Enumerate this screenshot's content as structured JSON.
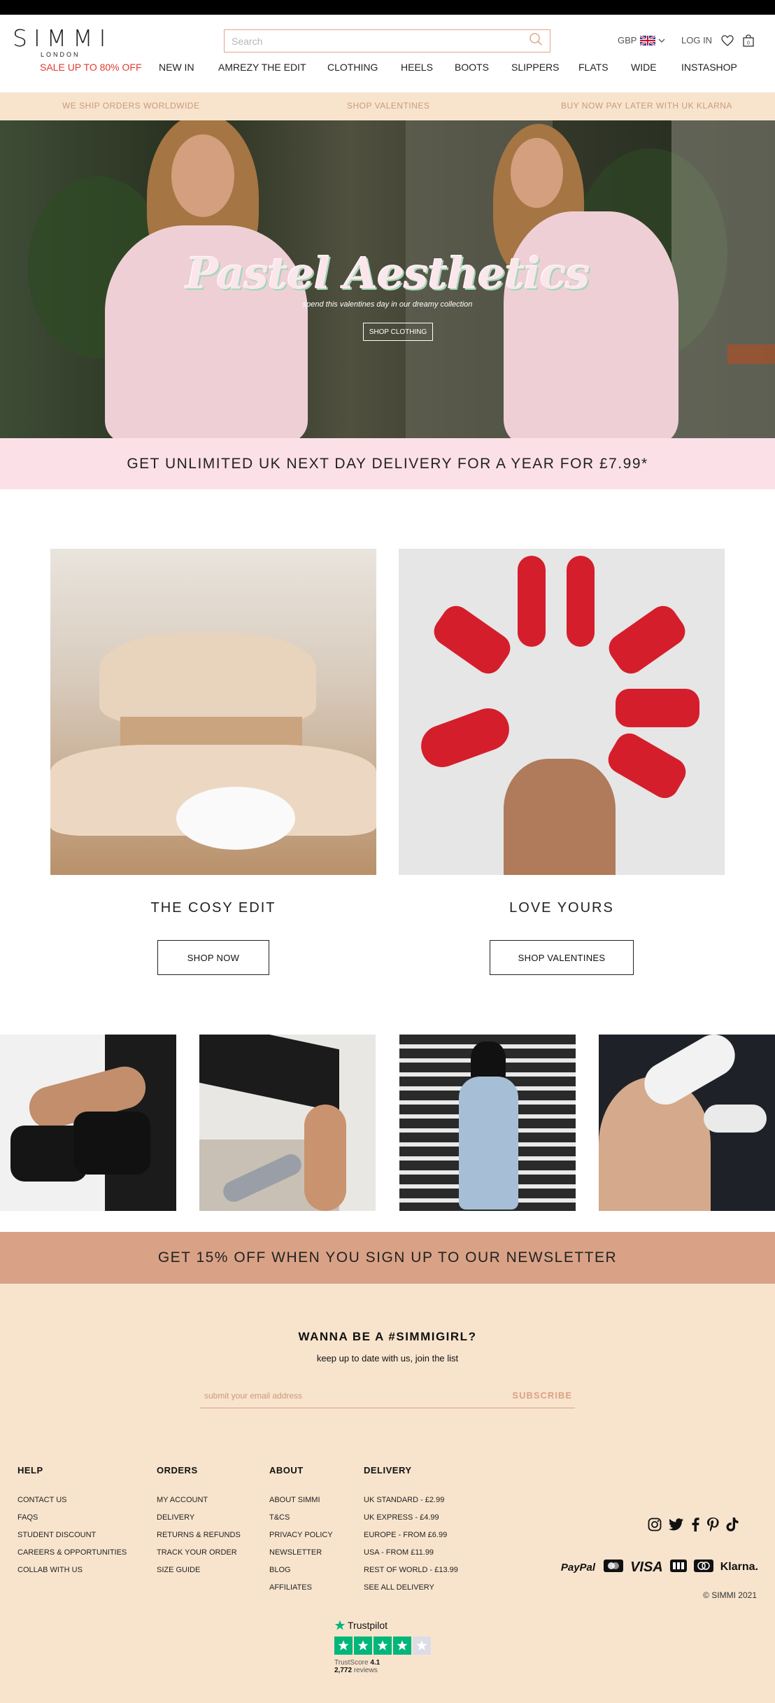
{
  "brand": {
    "name": "SIMMI",
    "sub": "LONDON"
  },
  "search": {
    "placeholder": "Search"
  },
  "header_utils": {
    "currency": "GBP",
    "login": "LOG IN"
  },
  "nav": {
    "sale": "SALE UP TO 80% OFF",
    "items": [
      "NEW IN",
      "AMREZY THE EDIT",
      "CLOTHING",
      "HEELS",
      "BOOTS",
      "SLIPPERS",
      "FLATS",
      "WIDE",
      "INSTASHOP"
    ]
  },
  "promo_bar": [
    "WE SHIP ORDERS WORLDWIDE",
    "SHOP VALENTINES",
    "BUY NOW PAY LATER WITH UK KLARNA"
  ],
  "hero": {
    "title": "Pastel Aesthetics",
    "subtitle": "spend this valentines day in our dreamy collection",
    "button": "SHOP CLOTHING"
  },
  "delivery_banner": "GET UNLIMITED UK NEXT DAY DELIVERY FOR A YEAR FOR £7.99*",
  "edits": [
    {
      "title": "THE COSY EDIT",
      "button": "SHOP NOW"
    },
    {
      "title": "LOVE YOURS",
      "button": "SHOP VALENTINES"
    }
  ],
  "newsletter_banner": "GET 15% OFF WHEN YOU SIGN UP TO OUR NEWSLETTER",
  "newsletter": {
    "title": "WANNA BE A #SIMMIGIRL?",
    "subtitle": "keep up to date with us, join the list",
    "placeholder": "submit your email address",
    "button": "SUBSCRIBE"
  },
  "footer": {
    "help": {
      "title": "HELP",
      "links": [
        "CONTACT US",
        "FAQS",
        "STUDENT DISCOUNT",
        "CAREERS & OPPORTUNITIES",
        "COLLAB WITH US"
      ]
    },
    "orders": {
      "title": "ORDERS",
      "links": [
        "MY ACCOUNT",
        "DELIVERY",
        "RETURNS & REFUNDS",
        "TRACK YOUR ORDER",
        "SIZE GUIDE"
      ]
    },
    "about": {
      "title": "ABOUT",
      "links": [
        "ABOUT SIMMI",
        "T&CS",
        "PRIVACY POLICY",
        "NEWSLETTER",
        "BLOG",
        "AFFILIATES"
      ]
    },
    "delivery": {
      "title": "DELIVERY",
      "links": [
        "UK STANDARD - £2.99",
        "UK EXPRESS - £4.99",
        "EUROPE - FROM £6.99",
        "USA - FROM £11.99",
        "REST OF WORLD - £13.99",
        "SEE ALL DELIVERY"
      ]
    },
    "payments": [
      "PayPal",
      "VISA",
      "Klarna."
    ],
    "copyright": "© SIMMI 2021",
    "social_icons": [
      "instagram-icon",
      "twitter-icon",
      "facebook-icon",
      "pinterest-icon",
      "tiktok-icon"
    ]
  },
  "trustpilot": {
    "name": "Trustpilot",
    "score_label": "TrustScore",
    "score": "4.1",
    "reviews_count": "2,772",
    "reviews_label": "reviews",
    "stars": 4
  },
  "colors": {
    "accent": "#e3a48a",
    "promo_bg": "#f8e4cd",
    "pink_banner": "#fce0e8",
    "nl_banner": "#d9a286",
    "sale": "#e23a2c",
    "trust_green": "#00b67a"
  }
}
